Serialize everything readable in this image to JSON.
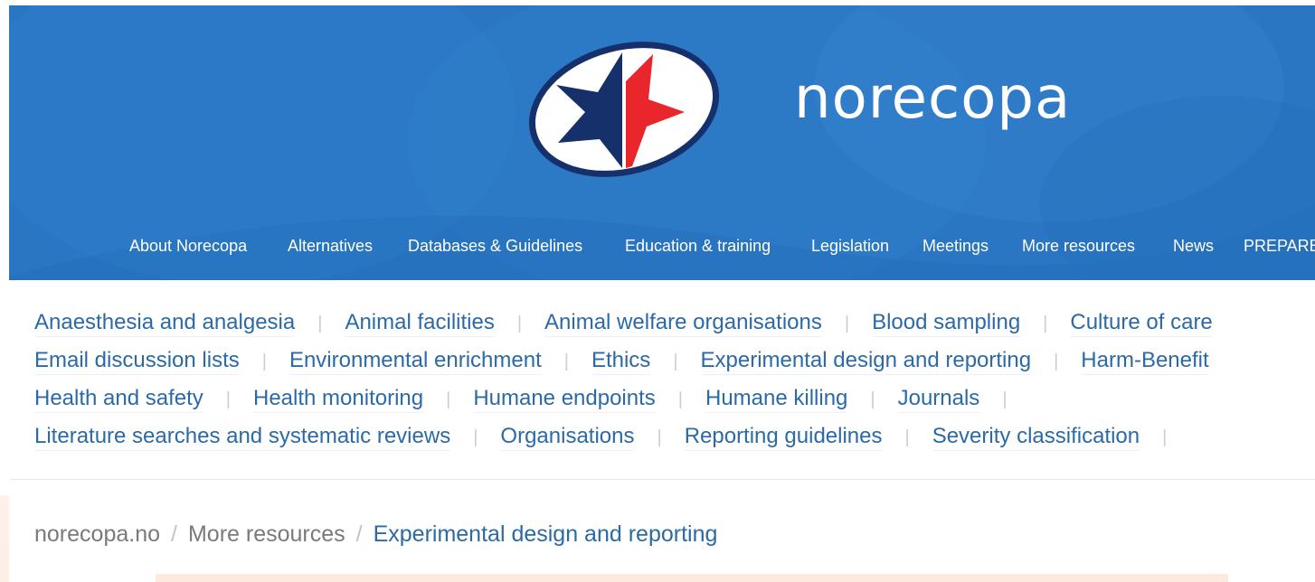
{
  "header": {
    "brand": "norecopa",
    "background_color": "#2a76c3",
    "logo_colors": {
      "navy": "#16306b",
      "red": "#e8262b"
    }
  },
  "topnav": {
    "items": [
      {
        "label": "About Norecopa"
      },
      {
        "label": "Alternatives"
      },
      {
        "label": "Databases & Guidelines"
      },
      {
        "label": "Education & training"
      },
      {
        "label": "Legislation"
      },
      {
        "label": "Meetings"
      },
      {
        "label": "More resources"
      },
      {
        "label": "News"
      },
      {
        "label": "PREPARE"
      }
    ]
  },
  "topics": {
    "separator": "|",
    "link_color": "#2b6aa6",
    "rows": [
      [
        "Anaesthesia and analgesia",
        "Animal facilities",
        "Animal welfare organisations",
        "Blood sampling",
        "Culture of care"
      ],
      [
        "Email discussion lists",
        "Environmental enrichment",
        "Ethics",
        "Experimental design and reporting",
        "Harm-Benefit"
      ],
      [
        "Health and safety",
        "Health monitoring",
        "Humane endpoints",
        "Humane killing",
        "Journals"
      ],
      [
        "Literature searches and systematic reviews",
        "Organisations",
        "Reporting guidelines",
        "Severity classification"
      ]
    ]
  },
  "breadcrumb": {
    "items": [
      "norecopa.no",
      "More resources"
    ],
    "separator": "/",
    "current": "Experimental design and reporting"
  }
}
